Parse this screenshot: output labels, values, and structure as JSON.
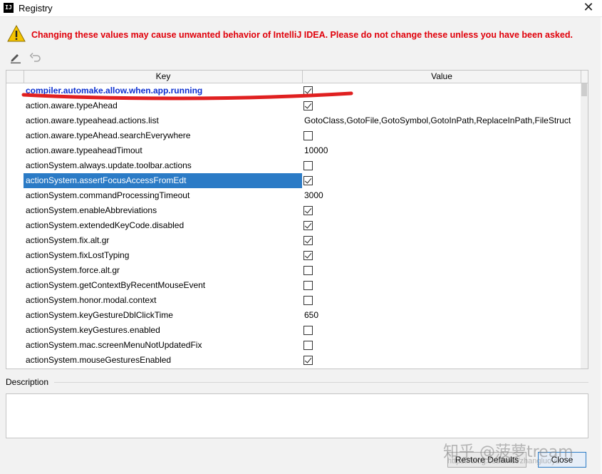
{
  "window": {
    "title": "Registry",
    "app_icon": "IJ",
    "close_glyph": "✕"
  },
  "warning": {
    "icon": "warning-triangle-icon",
    "text": "Changing these values may cause unwanted behavior of IntelliJ IDEA. Please do not change these unless you have been asked.",
    "color": "#e0000a"
  },
  "toolbar": {
    "edit_icon": "pencil-icon",
    "undo_icon": "revert-icon"
  },
  "table": {
    "columns": [
      "Key",
      "Value"
    ],
    "rows": [
      {
        "key": "compiler.automake.allow.when.app.running",
        "type": "bool",
        "value": true,
        "modified": true
      },
      {
        "key": "action.aware.typeAhead",
        "type": "bool",
        "value": true
      },
      {
        "key": "action.aware.typeahead.actions.list",
        "type": "text",
        "value": "GotoClass,GotoFile,GotoSymbol,GotoInPath,ReplaceInPath,FileStruct"
      },
      {
        "key": "action.aware.typeAhead.searchEverywhere",
        "type": "bool",
        "value": false
      },
      {
        "key": "action.aware.typeaheadTimout",
        "type": "text",
        "value": "10000"
      },
      {
        "key": "actionSystem.always.update.toolbar.actions",
        "type": "bool",
        "value": false
      },
      {
        "key": "actionSystem.assertFocusAccessFromEdt",
        "type": "bool",
        "value": true,
        "selected": true
      },
      {
        "key": "actionSystem.commandProcessingTimeout",
        "type": "text",
        "value": "3000"
      },
      {
        "key": "actionSystem.enableAbbreviations",
        "type": "bool",
        "value": true
      },
      {
        "key": "actionSystem.extendedKeyCode.disabled",
        "type": "bool",
        "value": true
      },
      {
        "key": "actionSystem.fix.alt.gr",
        "type": "bool",
        "value": true
      },
      {
        "key": "actionSystem.fixLostTyping",
        "type": "bool",
        "value": true
      },
      {
        "key": "actionSystem.force.alt.gr",
        "type": "bool",
        "value": false
      },
      {
        "key": "actionSystem.getContextByRecentMouseEvent",
        "type": "bool",
        "value": false
      },
      {
        "key": "actionSystem.honor.modal.context",
        "type": "bool",
        "value": false
      },
      {
        "key": "actionSystem.keyGestureDblClickTime",
        "type": "text",
        "value": "650"
      },
      {
        "key": "actionSystem.keyGestures.enabled",
        "type": "bool",
        "value": false
      },
      {
        "key": "actionSystem.mac.screenMenuNotUpdatedFix",
        "type": "bool",
        "value": false
      },
      {
        "key": "actionSystem.mouseGesturesEnabled",
        "type": "bool",
        "value": true
      }
    ]
  },
  "description": {
    "label": "Description",
    "text": ""
  },
  "buttons": {
    "restore": "Restore Defaults",
    "close": "Close"
  },
  "watermark": {
    "line1": "知乎 @菠萝tream",
    "line2": "https://blog.csdn.net/zhangluoyu"
  }
}
